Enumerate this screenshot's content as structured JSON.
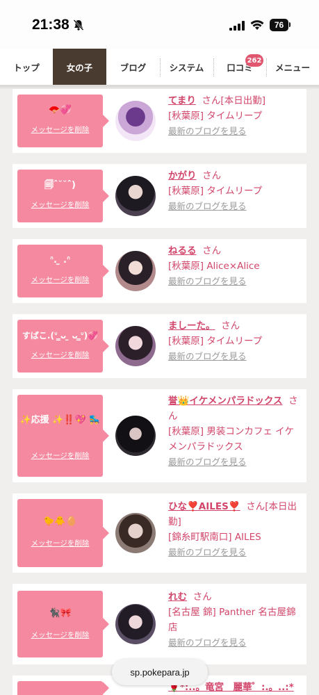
{
  "status": {
    "time": "21:38",
    "battery": "76"
  },
  "nav": {
    "tabs": [
      "トップ",
      "女の子",
      "ブログ",
      "システム",
      "口コミ",
      "メニュー"
    ],
    "badge": "262"
  },
  "cards": [
    {
      "message": "🪭💞",
      "delete": "メッセージを削除",
      "name": "てまり",
      "san": "さん",
      "status": "[本日出勤]",
      "shop": "[秋葉原] タイムリープ",
      "blog": "最新のブログを見る"
    },
    {
      "message": "🗐ˆ˘˘ˆ)",
      "delete": "メッセージを削除",
      "name": "かがり",
      "san": "さん",
      "status": "",
      "shop": "[秋葉原] タイムリープ",
      "blog": "最新のブログを見る"
    },
    {
      "message": "ᐢ. ̫ .ᐢ",
      "delete": "メッセージを削除",
      "name": "ねるる",
      "san": "さん",
      "status": "",
      "shop": "[秋葉原] Alice×Alice",
      "blog": "最新のブログを見る"
    },
    {
      "message": "すばこ.(ᐡ ̳ᴗ ̫ ᴗ ̳ᐡ)💞",
      "delete": "メッセージを削除",
      "name": "ましーた。",
      "san": "さん",
      "status": "",
      "shop": "[秋葉原] タイムリープ",
      "blog": "最新のブログを見る"
    },
    {
      "message": "✨応援 ✨‼️💖 🛼",
      "delete": "メッセージを削除",
      "name": "誉👑イケメンパラドックス",
      "san": "さん",
      "status": "",
      "shop": "[秋葉原] 男装コンカフェ イケメンパラドックス",
      "blog": "最新のブログを見る"
    },
    {
      "message": "🐤🐥🥚",
      "delete": "メッセージを削除",
      "name": "ひな❣️AILES❣️",
      "san": "さん",
      "status": "[本日出勤]",
      "shop": "[錦糸町駅南口] AILES",
      "blog": "最新のブログを見る"
    },
    {
      "message": "🐈‍⬛🎀",
      "delete": "メッセージを削除",
      "name": "れむ",
      "san": "さん",
      "status": "",
      "shop": "[名古屋 錦] Panther 名古屋錦店",
      "blog": "最新のブログを見る"
    },
    {
      "message": "",
      "delete": "",
      "name": "🌹*:..。竜宮　麗華゜:.。..:*",
      "san": "",
      "status": "",
      "shop": "",
      "blog": ""
    }
  ],
  "url": "sp.pokepara.jp",
  "colors": {
    "nav_active": "#4a3b31",
    "bubble": "#f4899f",
    "accent": "#d1466a",
    "badge": "#e0576f"
  }
}
